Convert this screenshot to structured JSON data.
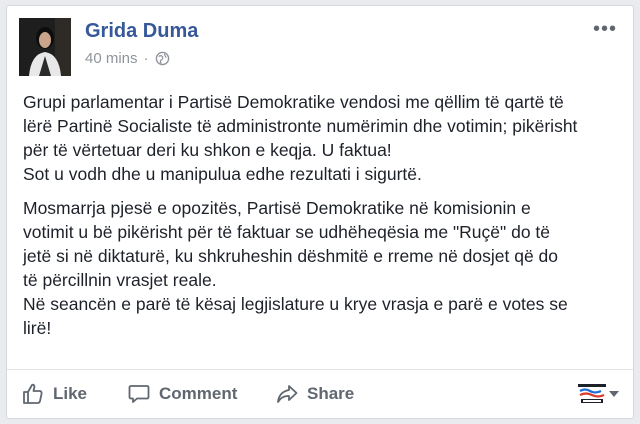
{
  "post": {
    "author": "Grida Duma",
    "time": "40 mins",
    "separator": "·",
    "options": "•••",
    "paragraphs": [
      [
        "Grupi parlamentar i Partisë Demokratike vendosi me qëllim të qartë të",
        "lërë Partinë Socialiste të administronte numërimin dhe votimin; pikërisht",
        "për të vërtetuar deri ku shkon e keqja. U faktua!",
        "Sot u vodh dhe u manipulua edhe rezultati i sigurtë."
      ],
      [
        "Mosmarrja pjesë e opozitës, Partisë Demokratike në komisionin e",
        "votimit u bë pikërisht për të faktuar se udhëheqësia me \"Ruçë\" do të",
        "jetë si në diktaturë, ku shkruheshin dëshmitë e rreme në dosjet që do",
        "të përcillnin vrasjet reale.",
        "Në seancën e parë të kësaj legjislature u krye vrasja e parë e votes se",
        "lirë!"
      ]
    ]
  },
  "actions": {
    "like": "Like",
    "comment": "Comment",
    "share": "Share"
  },
  "icons": {
    "globe": "globe-icon",
    "like": "thumbs-up-icon",
    "comment": "speech-bubble-icon",
    "share": "share-arrow-icon",
    "brand": "newspaper-logo",
    "caret": "caret-down-icon"
  },
  "colors": {
    "name": "#365899",
    "meta": "#90949c",
    "text": "#1d2129",
    "action": "#606770"
  }
}
